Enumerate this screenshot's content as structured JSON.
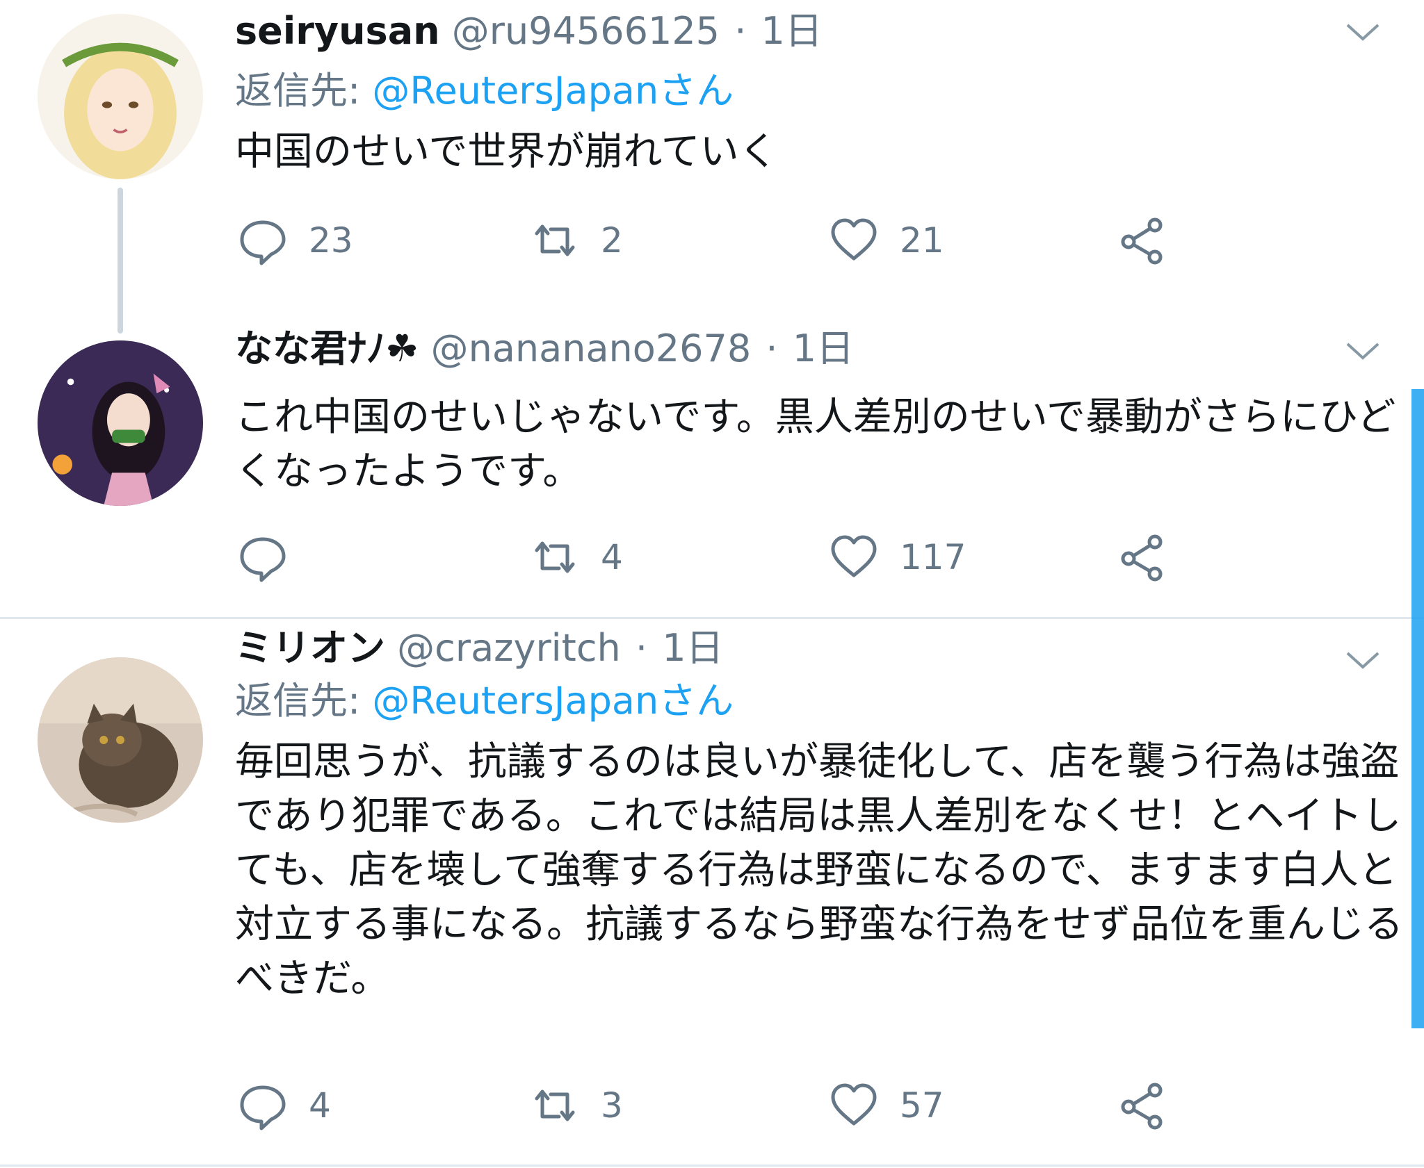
{
  "tweets": [
    {
      "name": "seiryusan",
      "handle": "@ru94566125",
      "separator": "·",
      "time": "1日",
      "reply_prefix": "返信先: ",
      "reply_mention": "@ReutersJapanさん",
      "text": "中国のせいで世界が崩れていく",
      "replies": "23",
      "retweets": "2",
      "likes": "21"
    },
    {
      "name": "なな君ﾅﾉ☘",
      "handle": "@nananano2678",
      "separator": "·",
      "time": "1日",
      "text": "これ中国のせいじゃないです。黒人差別のせいで暴動がさらにひどくなったようです。",
      "replies": "",
      "retweets": "4",
      "likes": "117"
    },
    {
      "name": "ミリオン",
      "handle": "@crazyritch",
      "separator": "·",
      "time": "1日",
      "reply_prefix": "返信先: ",
      "reply_mention": "@ReutersJapanさん",
      "text": "毎回思うが、抗議するのは良いが暴徒化して、店を襲う行為は強盗であり犯罪である。これでは結局は黒人差別をなくせ！とヘイトしても、店を壊して強奪する行為は野蛮になるので、ますます白人と対立する事になる。抗議するなら野蛮な行為をせず品位を重んじるべきだ。",
      "replies": "4",
      "retweets": "3",
      "likes": "57"
    }
  ],
  "icons": {
    "reply": "speech-bubble-icon",
    "retweet": "retweet-arrows-icon",
    "like": "heart-icon",
    "share": "share-nodes-icon",
    "more": "chevron-down-icon"
  },
  "colors": {
    "link": "#1da1f2",
    "muted": "#657786",
    "divider": "#e1e8ed"
  }
}
